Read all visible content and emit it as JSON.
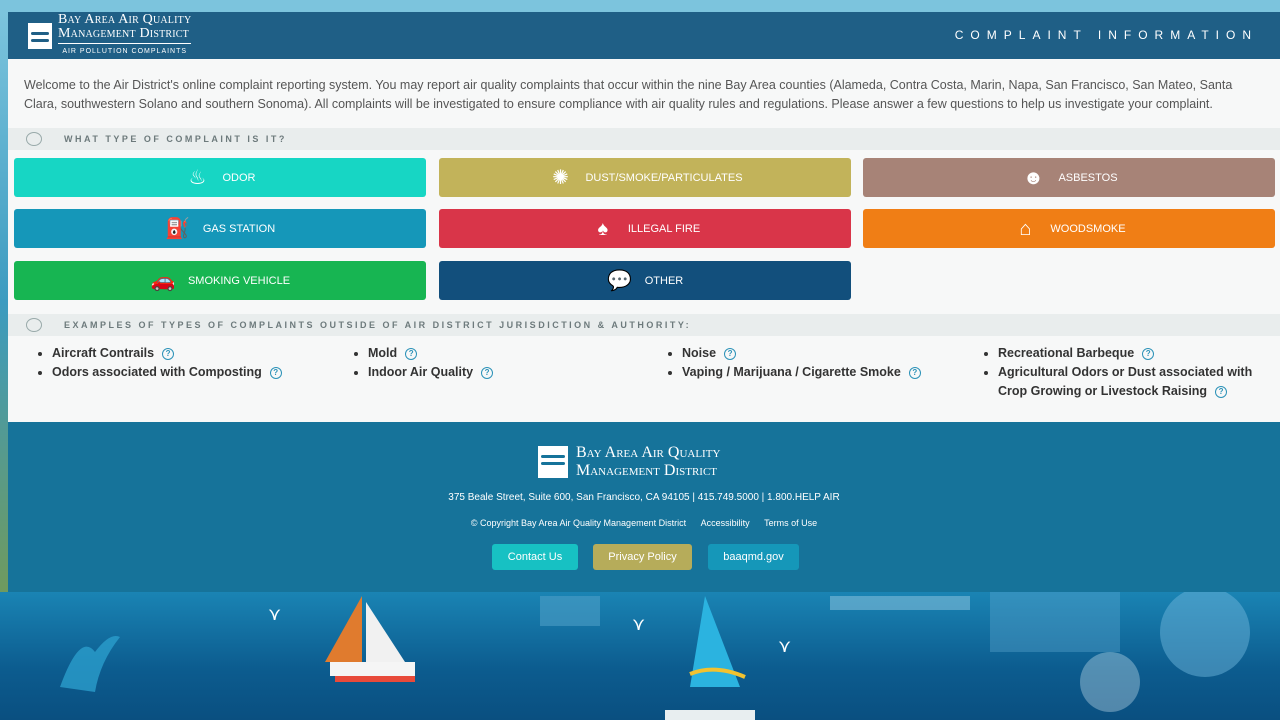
{
  "header": {
    "logo_line1": "Bay Area Air Quality",
    "logo_line2": "Management District",
    "logo_line3": "AIR POLLUTION COMPLAINTS",
    "title": "COMPLAINT INFORMATION"
  },
  "intro": "Welcome to the Air District's online complaint reporting system. You may report air quality complaints that occur within the nine Bay Area counties (Alameda, Contra Costa, Marin, Napa, San Francisco, San Mateo, Santa Clara, southwestern Solano and southern Sonoma). All complaints will be investigated to ensure compliance with air quality rules and regulations. Please answer a few questions to help us investigate your complaint.",
  "complaint_section": {
    "title": "WHAT TYPE OF COMPLAINT IS IT?",
    "buttons": [
      {
        "label": "ODOR",
        "icon": "odor-icon",
        "color": "#17d6c4"
      },
      {
        "label": "DUST/SMOKE/PARTICULATES",
        "icon": "dust-icon",
        "color": "#c2b35a"
      },
      {
        "label": "ASBESTOS",
        "icon": "asbestos-icon",
        "color": "#a78377"
      },
      {
        "label": "GAS STATION",
        "icon": "gas-pump-icon",
        "color": "#1597b9"
      },
      {
        "label": "ILLEGAL FIRE",
        "icon": "fire-icon",
        "color": "#d93549"
      },
      {
        "label": "WOODSMOKE",
        "icon": "house-smoke-icon",
        "color": "#f07e15"
      },
      {
        "label": "SMOKING VEHICLE",
        "icon": "car-smoke-icon",
        "color": "#17b552"
      },
      {
        "label": "OTHER",
        "icon": "speech-bubble-icon",
        "color": "#124f7c"
      }
    ]
  },
  "examples_section": {
    "title": "EXAMPLES OF TYPES OF COMPLAINTS OUTSIDE OF AIR DISTRICT JURISDICTION & AUTHORITY:",
    "columns": [
      [
        "Aircraft Contrails",
        "Odors associated with Composting"
      ],
      [
        "Mold",
        "Indoor Air Quality"
      ],
      [
        "Noise",
        "Vaping / Marijuana / Cigarette Smoke"
      ],
      [
        "Recreational Barbeque",
        "Agricultural Odors or Dust associated with Crop Growing or Livestock Raising"
      ]
    ]
  },
  "footer": {
    "logo_line1": "Bay Area Air Quality",
    "logo_line2": "Management District",
    "address": "375 Beale Street, Suite 600, San Francisco, CA 94105 | 415.749.5000 | 1.800.HELP AIR",
    "copyright": "© Copyright Bay Area Air Quality Management District",
    "accessibility": "Accessibility",
    "terms": "Terms of Use",
    "buttons": [
      {
        "label": "Contact Us",
        "color": "#17c1c3"
      },
      {
        "label": "Privacy Policy",
        "color": "#b6ac5a"
      },
      {
        "label": "baaqmd.gov",
        "color": "#1597b9"
      }
    ]
  }
}
